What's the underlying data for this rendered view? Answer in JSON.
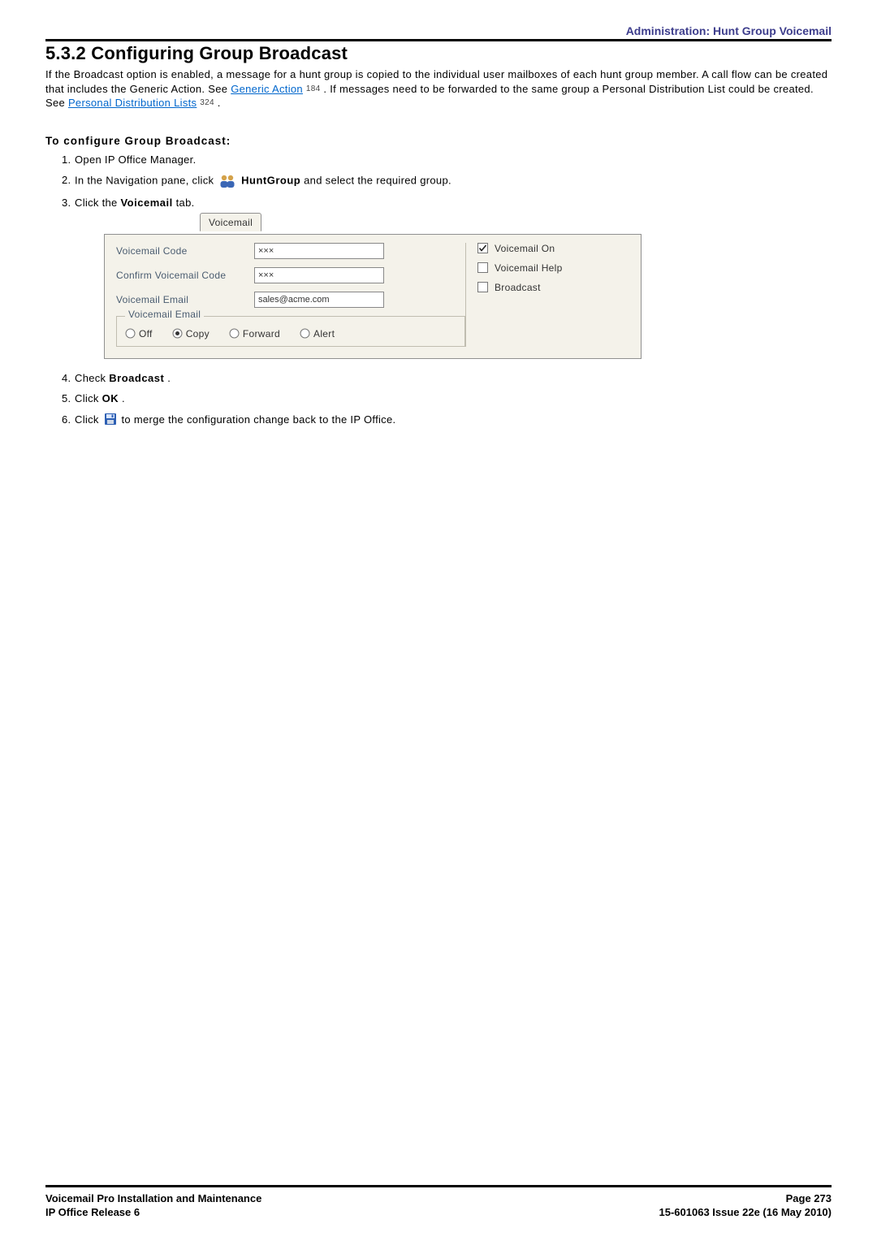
{
  "header": {
    "breadcrumb": "Administration: Hunt Group Voicemail"
  },
  "section": {
    "number": "5.3.2",
    "title": "Configuring Group Broadcast"
  },
  "intro": {
    "p1a": "If the Broadcast option is enabled, a message for a hunt group is copied to the individual user mailboxes of each hunt group member. A call flow can be created that includes the Generic Action. See ",
    "link1": "Generic Action",
    "ref1": "184",
    "p1b": ". If messages need to be forwarded to the same group a Personal Distribution List could be created. See ",
    "link2": "Personal Distribution Lists",
    "ref2": "324",
    "p1c": "."
  },
  "subheading": "To configure Group Broadcast:",
  "steps": {
    "s1": "Open IP Office Manager.",
    "s2a": "In the Navigation pane, click ",
    "s2b": " HuntGroup",
    "s2c": " and select the required group.",
    "s3": "Click the ",
    "s3b": "Voicemail",
    "s3c": " tab.",
    "s4a": "Check ",
    "s4b": "Broadcast",
    "s4c": ".",
    "s5a": "Click ",
    "s5b": "OK",
    "s5c": ".",
    "s6a": "Click ",
    "s6b": " to merge the configuration change back to the IP Office."
  },
  "panel": {
    "tab": "Voicemail",
    "labels": {
      "code": "Voicemail Code",
      "confirm": "Confirm Voicemail Code",
      "email": "Voicemail Email",
      "emailGroup": "Voicemail Email"
    },
    "values": {
      "code": "×××",
      "confirm": "×××",
      "email": "sales@acme.com"
    },
    "radios": {
      "off": "Off",
      "copy": "Copy",
      "forward": "Forward",
      "alert": "Alert",
      "selected": "copy"
    },
    "checks": {
      "on": "Voicemail On",
      "help": "Voicemail Help",
      "broadcast": "Broadcast"
    }
  },
  "footer": {
    "left1": "Voicemail Pro Installation and Maintenance",
    "left2": "IP Office Release 6",
    "right1": "Page 273",
    "right2": "15-601063 Issue 22e (16 May 2010)"
  }
}
